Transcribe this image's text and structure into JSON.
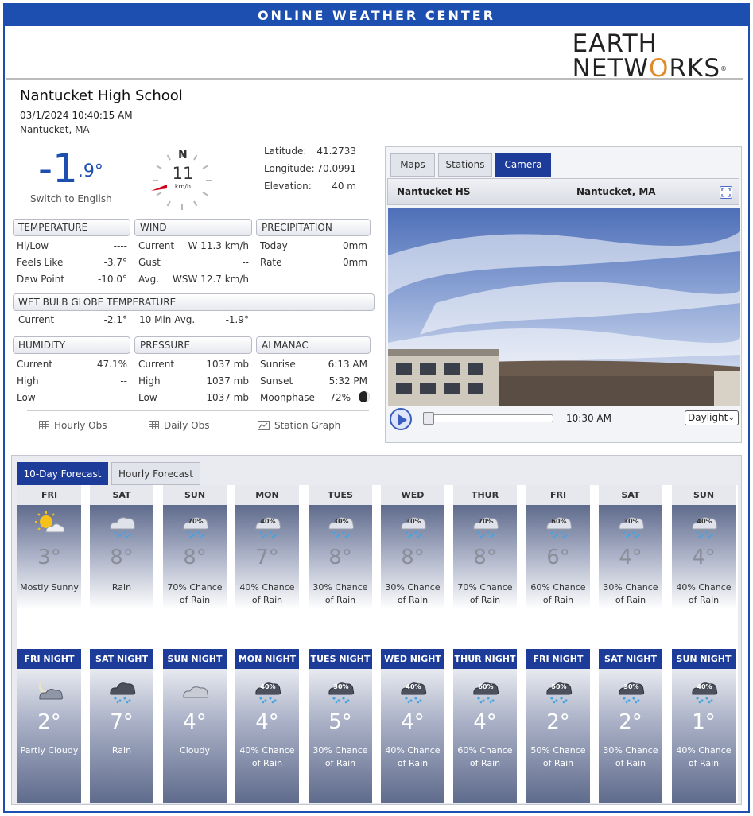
{
  "header": {
    "title": "ONLINE WEATHER CENTER"
  },
  "logo": {
    "line1": "EARTH",
    "line2": "NETWORKS",
    "tm": "®"
  },
  "station": {
    "name": "Nantucket High School",
    "datetime": "03/1/2024 10:40:15 AM",
    "location": "Nantucket, MA"
  },
  "current": {
    "temp_whole": "-1",
    "temp_decimal": ".9°",
    "switch_link": "Switch to English",
    "wind_speed": "11",
    "wind_unit": "km/h",
    "compass_n": "N"
  },
  "geo": {
    "latitude_label": "Latitude:",
    "latitude": "41.2733",
    "longitude_label": "Longitude:",
    "longitude": "-70.0991",
    "elevation_label": "Elevation:",
    "elevation": "40 m"
  },
  "temperature": {
    "title": "TEMPERATURE",
    "rows": [
      {
        "label": "Hi/Low",
        "value": "----"
      },
      {
        "label": "Feels Like",
        "value": "-3.7°"
      },
      {
        "label": "Dew Point",
        "value": "-10.0°"
      }
    ]
  },
  "wind": {
    "title": "WIND",
    "rows": [
      {
        "label": "Current",
        "value": "W 11.3 km/h"
      },
      {
        "label": "Gust",
        "value": "--"
      },
      {
        "label": "Avg.",
        "value": "WSW 12.7 km/h"
      }
    ]
  },
  "precipitation": {
    "title": "PRECIPITATION",
    "rows": [
      {
        "label": "Today",
        "value": "0mm"
      },
      {
        "label": "Rate",
        "value": "0mm"
      }
    ]
  },
  "wbgt": {
    "title": "WET BULB GLOBE TEMPERATURE",
    "current_label": "Current",
    "current": "-2.1°",
    "avg_label": "10 Min Avg.",
    "avg": "-1.9°"
  },
  "humidity": {
    "title": "HUMIDITY",
    "rows": [
      {
        "label": "Current",
        "value": "47.1%"
      },
      {
        "label": "High",
        "value": "--"
      },
      {
        "label": "Low",
        "value": "--"
      }
    ]
  },
  "pressure": {
    "title": "PRESSURE",
    "rows": [
      {
        "label": "Current",
        "value": "1037 mb"
      },
      {
        "label": "High",
        "value": "1037 mb"
      },
      {
        "label": "Low",
        "value": "1037 mb"
      }
    ]
  },
  "almanac": {
    "title": "ALMANAC",
    "rows": [
      {
        "label": "Sunrise",
        "value": "6:13 AM"
      },
      {
        "label": "Sunset",
        "value": "5:32 PM"
      },
      {
        "label": "Moonphase",
        "value": "72%"
      }
    ]
  },
  "links": {
    "hourly": "Hourly Obs",
    "daily": "Daily Obs",
    "graph": "Station Graph"
  },
  "camera": {
    "tabs": [
      "Maps",
      "Stations",
      "Camera"
    ],
    "active_tab": "Camera",
    "cam_name": "Nantucket HS",
    "cam_location": "Nantucket, MA",
    "time": "10:30 AM",
    "mode": "Daylight"
  },
  "forecast": {
    "tabs": [
      "10-Day Forecast",
      "Hourly Forecast"
    ],
    "days": [
      {
        "day": "FRI",
        "temp": "3°",
        "desc1": "Mostly Sunny",
        "desc2": "",
        "icon": "sun-cloud-icon",
        "pct": ""
      },
      {
        "day": "SAT",
        "temp": "8°",
        "desc1": "Rain",
        "desc2": "",
        "icon": "rain-icon",
        "pct": ""
      },
      {
        "day": "SUN",
        "temp": "8°",
        "desc1": "70% Chance",
        "desc2": "of Rain",
        "icon": "rain-icon",
        "pct": "70%"
      },
      {
        "day": "MON",
        "temp": "7°",
        "desc1": "40% Chance",
        "desc2": "of Rain",
        "icon": "rain-icon",
        "pct": "40%"
      },
      {
        "day": "TUES",
        "temp": "8°",
        "desc1": "30% Chance",
        "desc2": "of Rain",
        "icon": "rain-icon",
        "pct": "30%"
      },
      {
        "day": "WED",
        "temp": "8°",
        "desc1": "30% Chance",
        "desc2": "of Rain",
        "icon": "rain-icon",
        "pct": "30%"
      },
      {
        "day": "THUR",
        "temp": "8°",
        "desc1": "70% Chance",
        "desc2": "of Rain",
        "icon": "rain-icon",
        "pct": "70%"
      },
      {
        "day": "FRI",
        "temp": "6°",
        "desc1": "60% Chance",
        "desc2": "of Rain",
        "icon": "rain-icon",
        "pct": "60%"
      },
      {
        "day": "SAT",
        "temp": "4°",
        "desc1": "30% Chance",
        "desc2": "of Rain",
        "icon": "rain-icon",
        "pct": "30%"
      },
      {
        "day": "SUN",
        "temp": "4°",
        "desc1": "40% Chance",
        "desc2": "of Rain",
        "icon": "rain-icon",
        "pct": "40%"
      }
    ],
    "nights": [
      {
        "day": "FRI NIGHT",
        "temp": "2°",
        "desc1": "Partly Cloudy",
        "desc2": "",
        "icon": "moon-cloud-icon",
        "pct": ""
      },
      {
        "day": "SAT NIGHT",
        "temp": "7°",
        "desc1": "Rain",
        "desc2": "",
        "icon": "rain-icon",
        "pct": ""
      },
      {
        "day": "SUN NIGHT",
        "temp": "4°",
        "desc1": "Cloudy",
        "desc2": "",
        "icon": "cloud-icon",
        "pct": ""
      },
      {
        "day": "MON NIGHT",
        "temp": "4°",
        "desc1": "40% Chance",
        "desc2": "of Rain",
        "icon": "rain-icon",
        "pct": "40%"
      },
      {
        "day": "TUES NIGHT",
        "temp": "5°",
        "desc1": "30% Chance",
        "desc2": "of Rain",
        "icon": "rain-icon",
        "pct": "30%"
      },
      {
        "day": "WED NIGHT",
        "temp": "4°",
        "desc1": "40% Chance",
        "desc2": "of Rain",
        "icon": "rain-icon",
        "pct": "40%"
      },
      {
        "day": "THUR NIGHT",
        "temp": "4°",
        "desc1": "60% Chance",
        "desc2": "of Rain",
        "icon": "rain-icon",
        "pct": "60%"
      },
      {
        "day": "FRI NIGHT",
        "temp": "2°",
        "desc1": "50% Chance",
        "desc2": "of Rain",
        "icon": "rain-icon",
        "pct": "50%"
      },
      {
        "day": "SAT NIGHT",
        "temp": "2°",
        "desc1": "30% Chance",
        "desc2": "of Rain",
        "icon": "rain-icon",
        "pct": "30%"
      },
      {
        "day": "SUN NIGHT",
        "temp": "1°",
        "desc1": "40% Chance",
        "desc2": "of Rain",
        "icon": "rain-icon",
        "pct": "40%"
      }
    ]
  },
  "colors": {
    "brand_blue": "#1d4fb0",
    "tab_active": "#1d3c9a",
    "logo_orange": "#e08a2a"
  }
}
